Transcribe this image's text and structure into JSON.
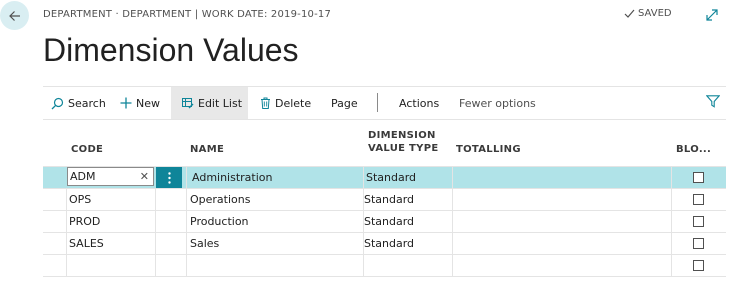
{
  "header": {
    "context": "DEPARTMENT · DEPARTMENT | WORK DATE: 2019-10-17",
    "saved": "SAVED",
    "title": "Dimension Values"
  },
  "icons": {
    "back": "arrow-left-icon",
    "saved": "check-icon",
    "expand": "expand-diagonal-icon",
    "search": "search-icon",
    "new": "plus-icon",
    "edit_list": "edit-list-icon",
    "delete": "trash-icon",
    "filter": "filter-icon",
    "row_actions": "more-vertical-icon",
    "clear": "close-icon"
  },
  "actions": {
    "search": "Search",
    "new": "New",
    "edit_list": "Edit List",
    "delete": "Delete",
    "page": "Page",
    "actions": "Actions",
    "fewer": "Fewer options"
  },
  "columns": {
    "code": "CODE",
    "name": "NAME",
    "type_line1": "DIMENSION",
    "type_line2": "VALUE TYPE",
    "totalling": "TOTALLING",
    "blocked": "BLO..."
  },
  "rows": [
    {
      "code": "ADM",
      "name": "Administration",
      "type": "Standard",
      "totalling": "",
      "blocked": false
    },
    {
      "code": "OPS",
      "name": "Operations",
      "type": "Standard",
      "totalling": "",
      "blocked": false
    },
    {
      "code": "PROD",
      "name": "Production",
      "type": "Standard",
      "totalling": "",
      "blocked": false
    },
    {
      "code": "SALES",
      "name": "Sales",
      "type": "Standard",
      "totalling": "",
      "blocked": false
    },
    {
      "code": "",
      "name": "",
      "type": "",
      "totalling": "",
      "blocked": false
    }
  ],
  "colors": {
    "accent": "#0f8599",
    "selected_row": "#b0e3e8",
    "back_button": "#d9eef2"
  }
}
